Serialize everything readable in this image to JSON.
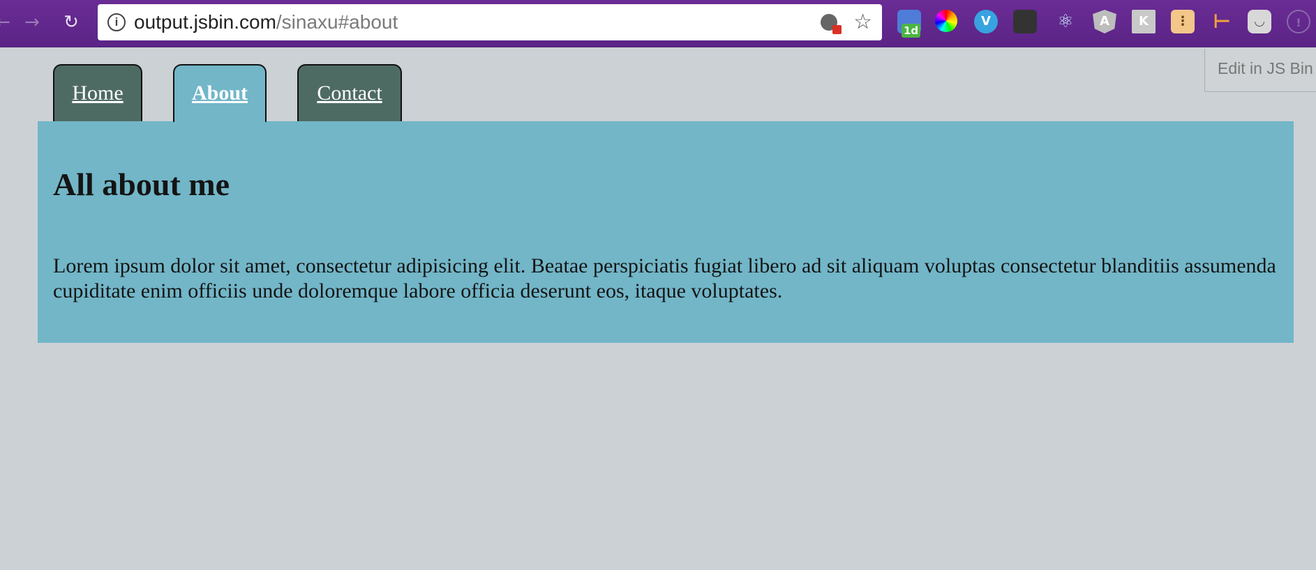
{
  "browser": {
    "url_host": "output.jsbin.com",
    "url_path": "/sinaxu#about",
    "extensions": [
      {
        "name": "calendar-icon",
        "badge": "1d"
      },
      {
        "name": "color-wheel-icon"
      },
      {
        "name": "v-icon",
        "glyph": "V"
      },
      {
        "name": "glasses-icon"
      },
      {
        "name": "react-icon",
        "glyph": "⚛"
      },
      {
        "name": "angular-icon",
        "glyph": "A"
      },
      {
        "name": "k-icon",
        "glyph": "K"
      },
      {
        "name": "face-icon",
        "glyph": "⋮"
      },
      {
        "name": "t-icon",
        "glyph": "⊢"
      },
      {
        "name": "pocket-icon",
        "glyph": "◡"
      },
      {
        "name": "info-menu-icon",
        "glyph": "!"
      }
    ]
  },
  "page": {
    "edit_link": "Edit in JS Bin",
    "tabs": [
      {
        "label": "Home",
        "active": false
      },
      {
        "label": "About",
        "active": true
      },
      {
        "label": "Contact",
        "active": false
      }
    ],
    "heading": "All about me",
    "paragraph": "Lorem ipsum dolor sit amet, consectetur adipisicing elit. Beatae perspiciatis fugiat libero ad sit aliquam voluptas consectetur blanditiis assumenda cupiditate enim officiis unde doloremque labore officia deserunt eos, itaque voluptates."
  },
  "colors": {
    "page_bg": "#ccd1d5",
    "tab_inactive": "#4e6b63",
    "tab_active": "#72b6c8",
    "panel_bg": "#72b6c8",
    "chrome_bg": "#5b2486"
  }
}
